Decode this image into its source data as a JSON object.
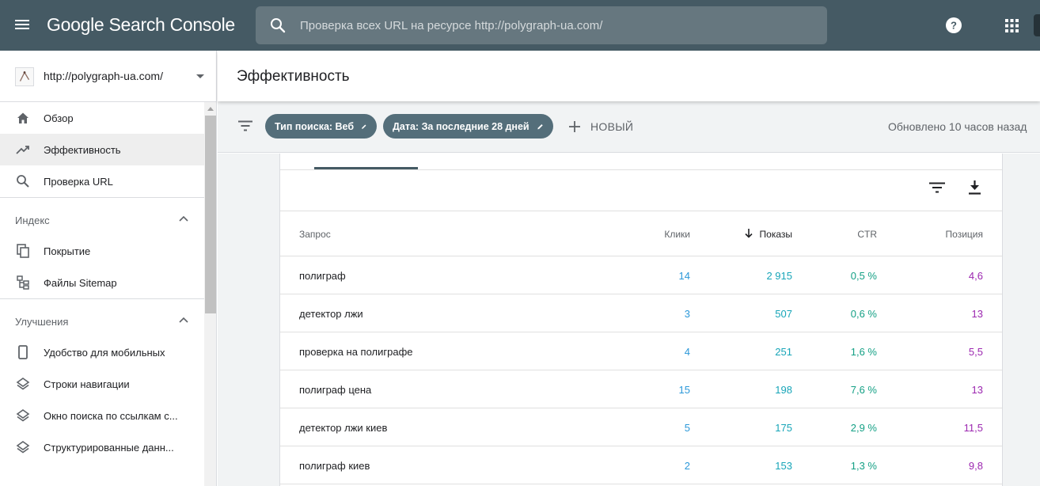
{
  "app": {
    "title": "Google Search Console",
    "search_placeholder": "Проверка всех URL на ресурсе http://polygraph-ua.com/"
  },
  "sidebar": {
    "property": "http://polygraph-ua.com/",
    "items_top": [
      {
        "label": "Обзор",
        "icon": "home-icon"
      },
      {
        "label": "Эффективность",
        "icon": "trending-up-icon",
        "active": true
      },
      {
        "label": "Проверка URL",
        "icon": "search-icon"
      }
    ],
    "index_section": {
      "label": "Индекс",
      "items": [
        {
          "label": "Покрытие",
          "icon": "file-copy-icon"
        },
        {
          "label": "Файлы Sitemap",
          "icon": "sitemap-icon"
        }
      ]
    },
    "enhancements_section": {
      "label": "Улучшения",
      "items": [
        {
          "label": "Удобство для мобильных",
          "icon": "smartphone-icon"
        },
        {
          "label": "Строки навигации",
          "icon": "layers-icon"
        },
        {
          "label": "Окно поиска по ссылкам с...",
          "icon": "layers-icon"
        },
        {
          "label": "Структурированные данн...",
          "icon": "layers-icon"
        }
      ]
    }
  },
  "main": {
    "page_title": "Эффективность",
    "filters": {
      "chip_search_type": "Тип поиска: Веб",
      "chip_date": "Дата: За последние 28 дней",
      "new_label": "НОВЫЙ",
      "updated": "Обновлено 10 часов назад"
    },
    "table": {
      "headers": {
        "query": "Запрос",
        "clicks": "Клики",
        "impressions": "Показы",
        "ctr": "CTR",
        "position": "Позиция"
      },
      "sorted_by": "impressions",
      "rows": [
        {
          "query": "полиграф",
          "clicks": "14",
          "impressions": "2 915",
          "ctr": "0,5 %",
          "position": "4,6"
        },
        {
          "query": "детектор лжи",
          "clicks": "3",
          "impressions": "507",
          "ctr": "0,6 %",
          "position": "13"
        },
        {
          "query": "проверка на полиграфе",
          "clicks": "4",
          "impressions": "251",
          "ctr": "1,6 %",
          "position": "5,5"
        },
        {
          "query": "полиграф цена",
          "clicks": "15",
          "impressions": "198",
          "ctr": "7,6 %",
          "position": "13"
        },
        {
          "query": "детектор лжи киев",
          "clicks": "5",
          "impressions": "175",
          "ctr": "2,9 %",
          "position": "11,5"
        },
        {
          "query": "полиграф киев",
          "clicks": "2",
          "impressions": "153",
          "ctr": "1,3 %",
          "position": "9,8"
        }
      ]
    }
  },
  "colors": {
    "topbar": "#455a64",
    "chip": "#546e7a",
    "clicks": "#2b98d9",
    "impressions": "#17a5b8",
    "ctr": "#14a085",
    "position": "#9c27b0"
  }
}
